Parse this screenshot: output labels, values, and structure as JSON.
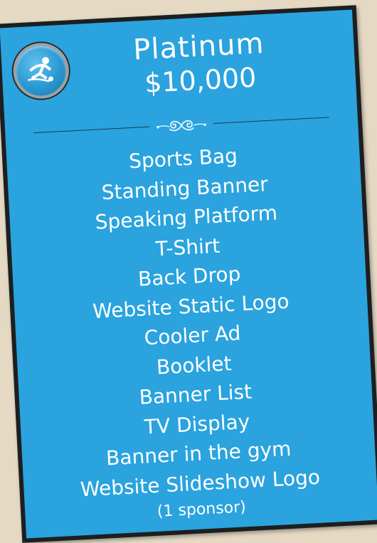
{
  "card": {
    "title": "Platinum",
    "price": "$10,000",
    "items": [
      "Sports Bag",
      "Standing Banner",
      "Speaking Platform",
      "T-Shirt",
      "Back Drop",
      "Website Static Logo",
      "Cooler Ad",
      "Booklet",
      "Banner List",
      "TV Display",
      "Banner in the gym",
      "Website Slideshow Logo"
    ],
    "note": "(1 sponsor)"
  },
  "icons": {
    "badge": "runner-icon",
    "divider": "flourish-ornament-icon"
  },
  "colors": {
    "card_background": "#2aa3de",
    "card_border": "#1e1e1e",
    "page_background": "#e5d9c4",
    "text": "#ffffff"
  }
}
